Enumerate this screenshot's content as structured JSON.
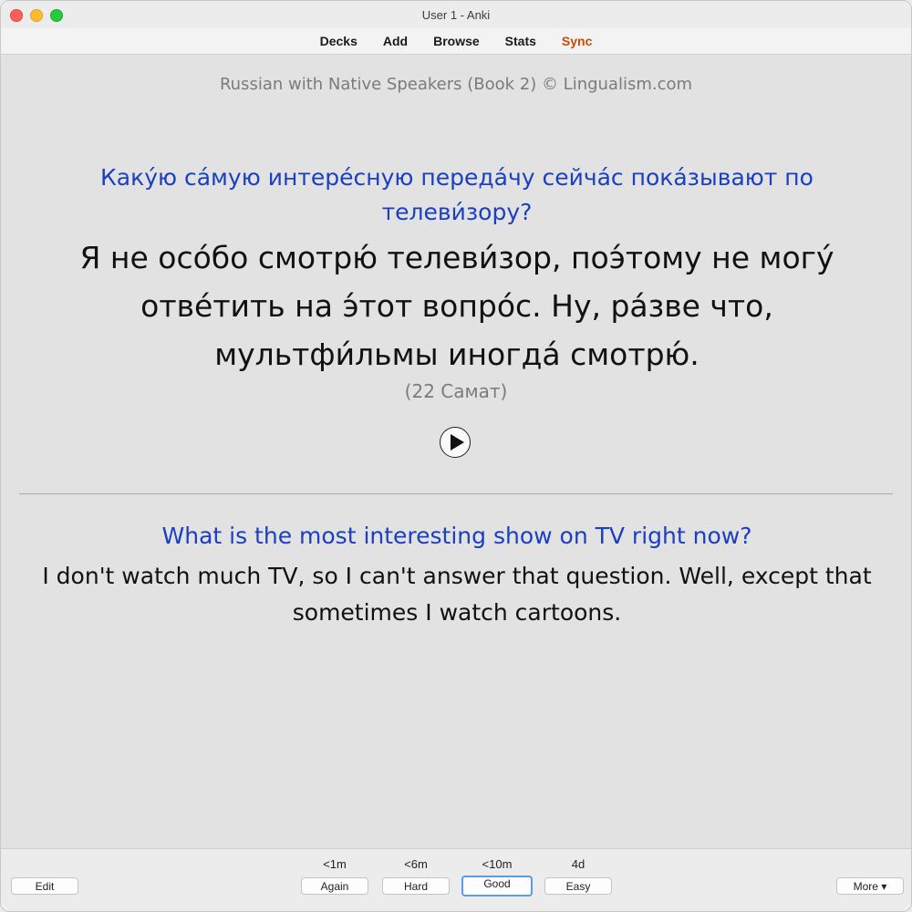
{
  "window": {
    "title": "User 1 - Anki"
  },
  "toolbar": {
    "decks": "Decks",
    "add": "Add",
    "browse": "Browse",
    "stats": "Stats",
    "sync": "Sync"
  },
  "card": {
    "source": "Russian with Native Speakers (Book 2) © Lingualism.com",
    "question_ru": "Каку́ю са́мую интере́сную переда́чу сейча́с пока́зывают по телеви́зору?",
    "answer_ru": "Я не осо́бо смотрю́ телеви́зор, поэ́тому не могу́ отве́тить на э́тот вопро́с. Ну, ра́зве что, мультфи́льмы иногда́ смотрю́.",
    "speaker": "(22 Самат)",
    "question_en": "What is the most interesting show on TV right now?",
    "answer_en": "I don't watch much TV, so I can't answer that question. Well, except that sometimes I watch cartoons."
  },
  "bottom": {
    "edit": "Edit",
    "again": {
      "label": "Again",
      "interval": "<1m"
    },
    "hard": {
      "label": "Hard",
      "interval": "<6m"
    },
    "good": {
      "label": "Good",
      "interval": "<10m"
    },
    "easy": {
      "label": "Easy",
      "interval": "4d"
    },
    "more": "More ▾"
  },
  "colors": {
    "sync": "#cc4a00",
    "question_blue": "#1a3fbf",
    "focus_ring": "#5a9bf0"
  }
}
